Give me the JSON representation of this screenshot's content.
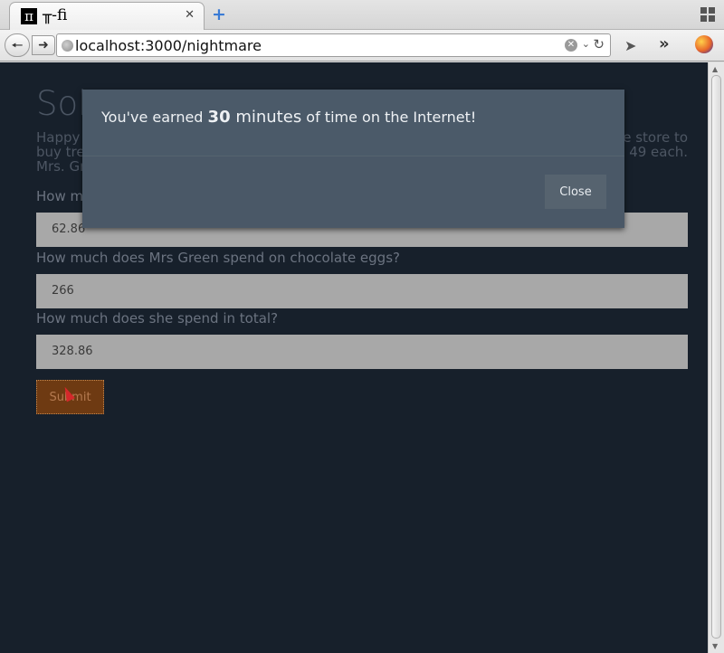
{
  "browser": {
    "tab_title": "╥-fi",
    "favicon_glyph": "π",
    "url": "localhost:3000/nightmare"
  },
  "page": {
    "title": "Solv",
    "intro_line1": "Happy",
    "intro_line1_right": "e store to",
    "intro_line2": "buy tre",
    "intro_line2_right": "49 each.",
    "intro_line3": "Mrs. Gr",
    "questions": [
      {
        "label": "How m",
        "value": "62.86"
      },
      {
        "label": "How much does Mrs Green spend on chocolate eggs?",
        "value": "266"
      },
      {
        "label": "How much does she spend in total?",
        "value": "328.86"
      }
    ],
    "submit_label": "Submit"
  },
  "modal": {
    "message_prefix": "You've earned ",
    "minutes_value": "30",
    "minutes_unit": " minutes",
    "message_suffix": " of time on the Internet!",
    "close_label": "Close"
  },
  "colors": {
    "page_bg": "#17202b",
    "modal_bg": "#4a5867",
    "submit_bg": "#6e3a12"
  }
}
